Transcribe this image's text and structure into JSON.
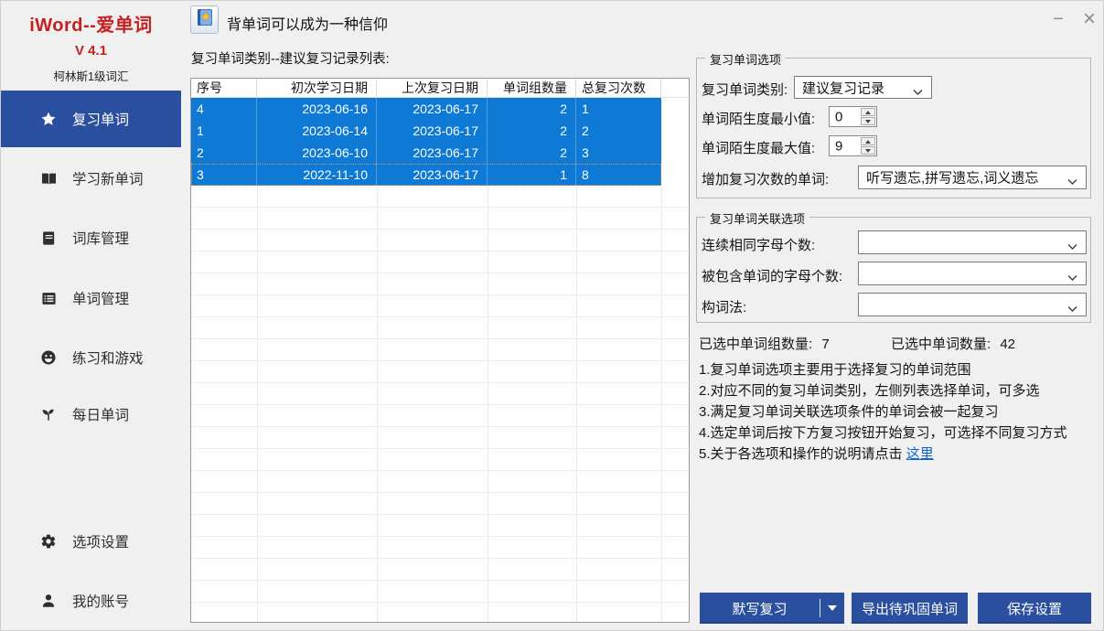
{
  "app": {
    "title": "iWord--爱单词",
    "version": "V 4.1",
    "subtitle": "柯林斯1级词汇",
    "motto": "背单词可以成为一种信仰",
    "window": {
      "minimize": "−",
      "close": "×"
    }
  },
  "colors": {
    "accent_blue": "#2b4f9f",
    "selection_blue": "#0e7ad6",
    "brand_red": "#c4201f",
    "link_blue": "#0f62d6"
  },
  "sidebar": {
    "items": [
      {
        "label": "复习单词",
        "icon": "star-icon",
        "active": true
      },
      {
        "label": "学习新单词",
        "icon": "open-book-icon",
        "active": false
      },
      {
        "label": "词库管理",
        "icon": "notebook-icon",
        "active": false
      },
      {
        "label": "单词管理",
        "icon": "word-list-icon",
        "active": false
      },
      {
        "label": "练习和游戏",
        "icon": "smiley-icon",
        "active": false
      },
      {
        "label": "每日单词",
        "icon": "sprout-icon",
        "active": false
      },
      {
        "label": "选项设置",
        "icon": "gear-icon",
        "active": false
      },
      {
        "label": "我的账号",
        "icon": "person-icon",
        "active": false
      }
    ]
  },
  "main": {
    "list_title": "复习单词类别--建议复习记录列表:",
    "table": {
      "columns": [
        "序号",
        "初次学习日期",
        "上次复习日期",
        "单词组数量",
        "总复习次数"
      ],
      "rows": [
        [
          "4",
          "2023-06-16",
          "2023-06-17",
          "2",
          "1"
        ],
        [
          "1",
          "2023-06-14",
          "2023-06-17",
          "2",
          "2"
        ],
        [
          "2",
          "2023-06-10",
          "2023-06-17",
          "2",
          "3"
        ],
        [
          "3",
          "2022-11-10",
          "2023-06-17",
          "1",
          "8"
        ]
      ],
      "all_rows_selected": true,
      "focused_row_index": 3
    }
  },
  "options_panel": {
    "title": "复习单词选项",
    "category_label": "复习单词类别:",
    "category_value": "建议复习记录",
    "min_label": "单词陌生度最小值:",
    "min_value": "0",
    "max_label": "单词陌生度最大值:",
    "max_value": "9",
    "increase_label": "增加复习次数的单词:",
    "increase_value": "听写遗忘,拼写遗忘,词义遗忘"
  },
  "assoc_panel": {
    "title": "复习单词关联选项",
    "same_letters_label": "连续相同字母个数:",
    "same_letters_value": "",
    "contained_label": "被包含单词的字母个数:",
    "contained_value": "",
    "word_formation_label": "构词法:",
    "word_formation_value": ""
  },
  "stats": {
    "groups_label": "已选中单词组数量:",
    "groups_value": "7",
    "words_label": "已选中单词数量:",
    "words_value": "42"
  },
  "notes": {
    "line1": "1.复习单词选项主要用于选择复习的单词范围",
    "line2": "2.对应不同的复习单词类别，左侧列表选择单词，可多选",
    "line3": "3.满足复习单词关联选项条件的单词会被一起复习",
    "line4": "4.选定单词后按下方复习按钮开始复习，可选择不同复习方式",
    "line5_text": "5.关于各选项和操作的说明请点击 ",
    "line5_link": "这里"
  },
  "footer": {
    "review_button": "默写复习",
    "export_button": "导出待巩固单词",
    "save_button": "保存设置"
  }
}
